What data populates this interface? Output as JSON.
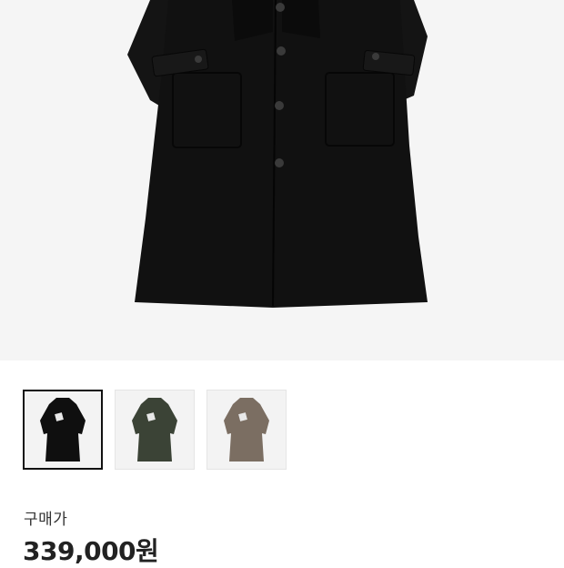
{
  "product": {
    "price_label": "구매가",
    "price_value": "339,000원",
    "main_image": {
      "icon": "coat-photo",
      "color": "#121212"
    },
    "thumbnails": [
      {
        "color": "#0f0f0f",
        "selected": true
      },
      {
        "color": "#3b4336",
        "selected": false
      },
      {
        "color": "#7b6e62",
        "selected": false
      }
    ]
  }
}
